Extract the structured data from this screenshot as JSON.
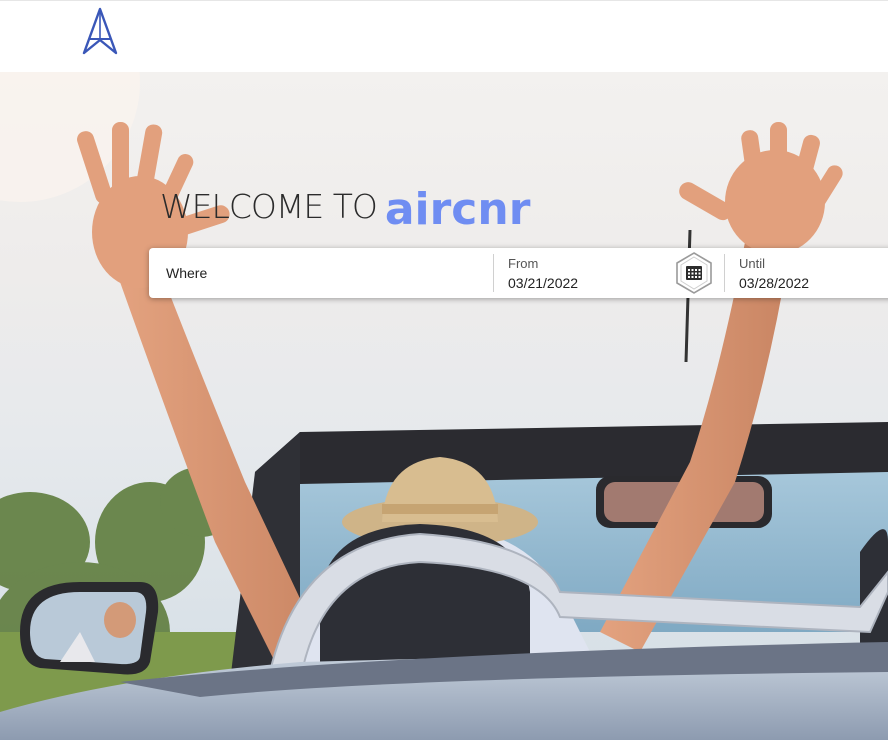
{
  "header": {
    "logo_icon": "airplane-a-logo-icon",
    "brand_color": "#3a57b8"
  },
  "hero": {
    "welcome_text": "WELCOME TO",
    "brand_name": "aircnr",
    "brand_color": "#6f8df2"
  },
  "search": {
    "where_placeholder": "Where",
    "from_label": "From",
    "from_value": "03/21/2022",
    "calendar_icon": "calendar-icon",
    "until_label": "Until",
    "until_value": "03/28/2022"
  }
}
